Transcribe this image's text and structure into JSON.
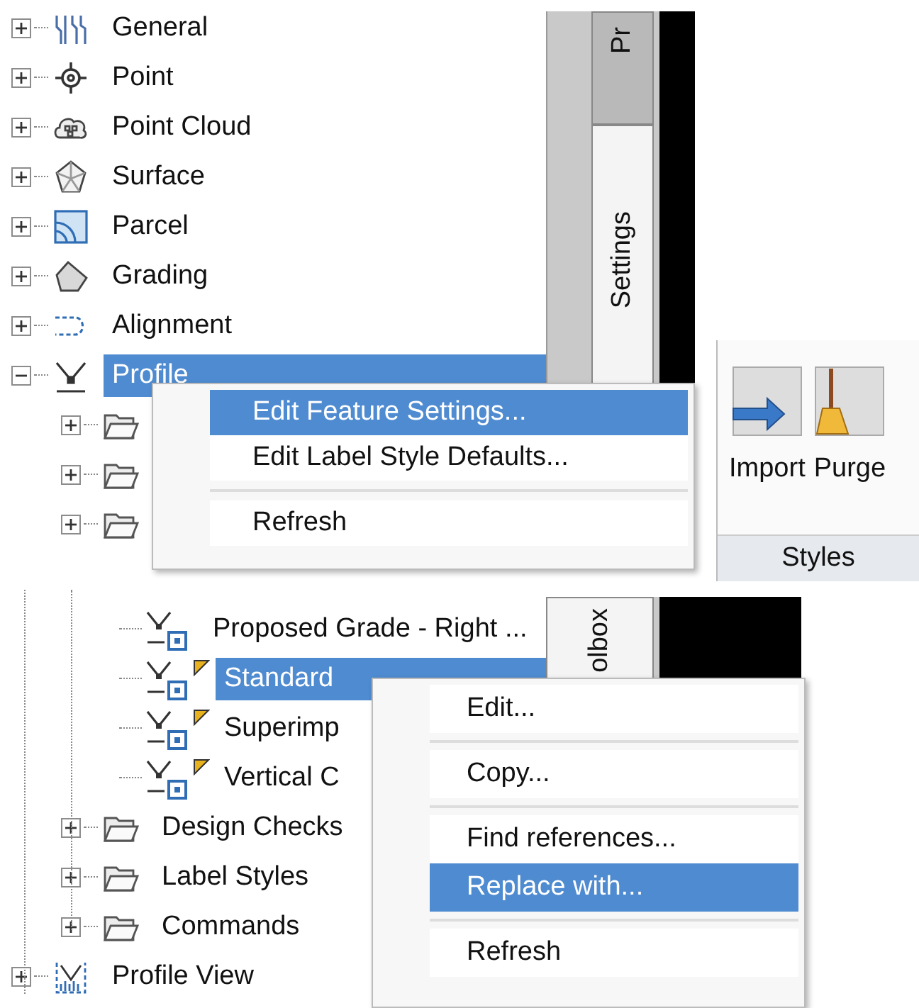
{
  "top_tree": {
    "items": [
      {
        "kind": "general",
        "label": "General",
        "expanded": false,
        "selected": false
      },
      {
        "kind": "point",
        "label": "Point",
        "expanded": false,
        "selected": false
      },
      {
        "kind": "point-cloud",
        "label": "Point Cloud",
        "expanded": false,
        "selected": false
      },
      {
        "kind": "surface",
        "label": "Surface",
        "expanded": false,
        "selected": false
      },
      {
        "kind": "parcel",
        "label": "Parcel",
        "expanded": false,
        "selected": false
      },
      {
        "kind": "grading",
        "label": "Grading",
        "expanded": false,
        "selected": false
      },
      {
        "kind": "alignment",
        "label": "Alignment",
        "expanded": false,
        "selected": false
      },
      {
        "kind": "profile",
        "label": "Profile",
        "expanded": true,
        "selected": true,
        "children": [
          {
            "kind": "folder",
            "expanded": false
          },
          {
            "kind": "folder",
            "expanded": false
          },
          {
            "kind": "folder",
            "expanded": false
          }
        ]
      }
    ]
  },
  "top_side_tabs": [
    {
      "label": "Pr",
      "selected": false
    },
    {
      "label": "Settings",
      "selected": true
    }
  ],
  "top_context_menu": {
    "items": [
      {
        "kind": "command",
        "label": "Edit Feature Settings...",
        "selected": true
      },
      {
        "kind": "command",
        "label": "Edit Label Style Defaults...",
        "selected": false
      },
      {
        "kind": "separator"
      },
      {
        "kind": "command",
        "label": "Refresh",
        "selected": false
      }
    ]
  },
  "ribbon": {
    "buttons": [
      {
        "kind": "import",
        "label": "Import"
      },
      {
        "kind": "purge",
        "label": "Purge"
      }
    ],
    "panel_title": "Styles"
  },
  "lower_tree": {
    "styles": [
      {
        "label": "Proposed Grade - Right ...",
        "flagged": false,
        "selected": false
      },
      {
        "label": "Standard",
        "flagged": true,
        "selected": true
      },
      {
        "label": "Superimp",
        "flagged": true,
        "selected": false
      },
      {
        "label": "Vertical C",
        "flagged": true,
        "selected": false
      }
    ],
    "folders": [
      {
        "label": "Design Checks",
        "expanded": false
      },
      {
        "label": "Label Styles",
        "expanded": false
      },
      {
        "label": "Commands",
        "expanded": false
      }
    ],
    "categories": [
      {
        "kind": "profile-view",
        "label": "Profile View",
        "expanded": false
      }
    ]
  },
  "lower_side_tab": {
    "label": "olbox"
  },
  "lower_context_menu": {
    "items": [
      {
        "kind": "command",
        "label": "Edit...",
        "selected": false
      },
      {
        "kind": "separator"
      },
      {
        "kind": "command",
        "label": "Copy...",
        "selected": false
      },
      {
        "kind": "separator"
      },
      {
        "kind": "command",
        "label": "Find references...",
        "selected": false
      },
      {
        "kind": "command",
        "label": "Replace with...",
        "selected": true
      },
      {
        "kind": "separator"
      },
      {
        "kind": "command",
        "label": "Refresh",
        "selected": false
      }
    ]
  }
}
